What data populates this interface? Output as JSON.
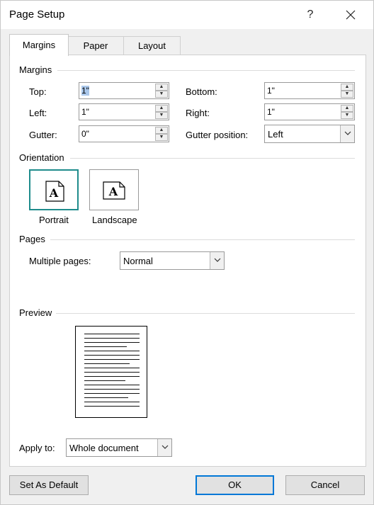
{
  "dialog": {
    "title": "Page Setup",
    "help_label": "?",
    "close_label": "✕"
  },
  "tabs": [
    {
      "label": "Margins",
      "active": true
    },
    {
      "label": "Paper",
      "active": false
    },
    {
      "label": "Layout",
      "active": false
    }
  ],
  "margins": {
    "group_label": "Margins",
    "top": {
      "label": "Top:",
      "value": "1\""
    },
    "bottom": {
      "label": "Bottom:",
      "value": "1\""
    },
    "left": {
      "label": "Left:",
      "value": "1\""
    },
    "right": {
      "label": "Right:",
      "value": "1\""
    },
    "gutter": {
      "label": "Gutter:",
      "value": "0\""
    },
    "gutter_position": {
      "label": "Gutter position:",
      "value": "Left"
    }
  },
  "orientation": {
    "group_label": "Orientation",
    "portrait_label": "Portrait",
    "landscape_label": "Landscape",
    "icon_glyph": "A",
    "selected": "portrait"
  },
  "pages": {
    "group_label": "Pages",
    "multiple_pages_label": "Multiple pages:",
    "multiple_pages_value": "Normal"
  },
  "preview": {
    "group_label": "Preview"
  },
  "apply_to": {
    "label": "Apply to:",
    "value": "Whole document"
  },
  "buttons": {
    "set_default": "Set As Default",
    "ok": "OK",
    "cancel": "Cancel"
  },
  "colors": {
    "accent_teal": "#1f8c8c",
    "focus_blue": "#0078d7",
    "selection": "#aac7ea"
  }
}
